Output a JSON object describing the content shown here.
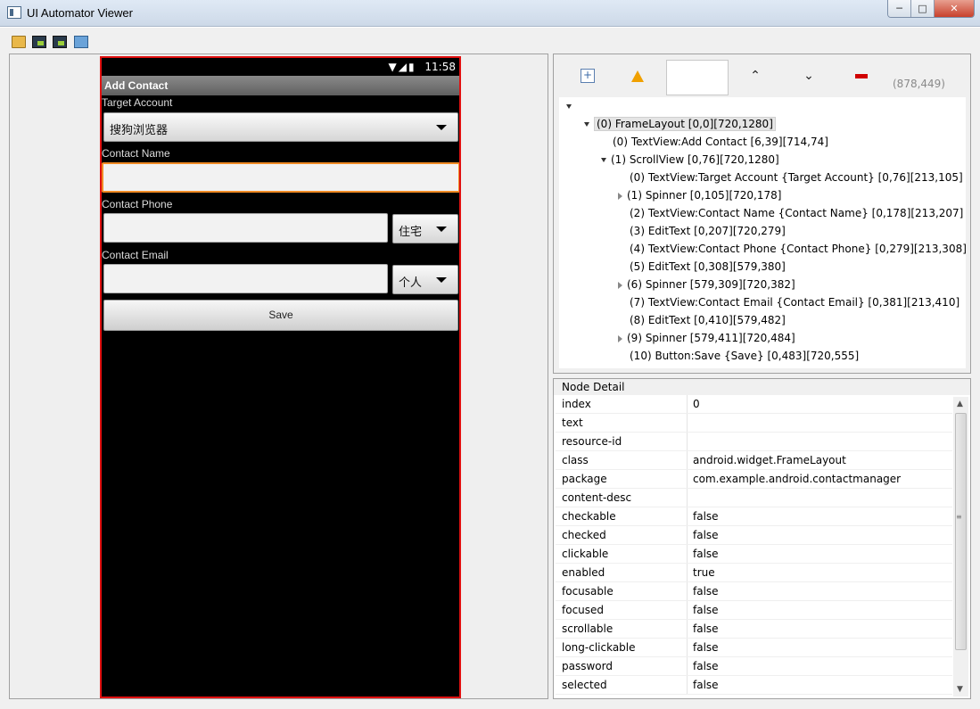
{
  "window": {
    "title": "UI Automator Viewer",
    "controls": [
      "─",
      "□",
      "✕"
    ]
  },
  "toolbar": {
    "icons": [
      "open-folder-icon",
      "device-screenshot-icon",
      "device-screenshot-compressed-icon",
      "save-icon"
    ]
  },
  "phone": {
    "status_time": "11:58",
    "status_icons": "wifi signal battery",
    "actionbar_title": "Add Contact",
    "target_account_label": "Target Account",
    "target_account_value": "搜狗浏览器",
    "contact_name_label": "Contact Name",
    "contact_name_value": "",
    "contact_phone_label": "Contact Phone",
    "contact_phone_value": "",
    "phone_type": "住宅",
    "contact_email_label": "Contact Email",
    "contact_email_value": "",
    "email_type": "个人",
    "save_label": "Save"
  },
  "hierarchy": {
    "search_value": "",
    "coords": "(878,449)",
    "nodes": [
      "(0) FrameLayout [0,0][720,1280]",
      "(0) TextView:Add Contact [6,39][714,74]",
      "(1) ScrollView [0,76][720,1280]",
      "(0) TextView:Target Account {Target Account} [0,76][213,105]",
      "(1) Spinner [0,105][720,178]",
      "(2) TextView:Contact Name {Contact Name} [0,178][213,207]",
      "(3) EditText [0,207][720,279]",
      "(4) TextView:Contact Phone {Contact Phone} [0,279][213,308]",
      "(5) EditText [0,308][579,380]",
      "(6) Spinner [579,309][720,382]",
      "(7) TextView:Contact Email {Contact Email} [0,381][213,410]",
      "(8) EditText [0,410][579,482]",
      "(9) Spinner [579,411][720,484]",
      "(10) Button:Save {Save} [0,483][720,555]"
    ]
  },
  "detail": {
    "title": "Node Detail",
    "rows": [
      {
        "key": "index",
        "value": "0"
      },
      {
        "key": "text",
        "value": ""
      },
      {
        "key": "resource-id",
        "value": ""
      },
      {
        "key": "class",
        "value": "android.widget.FrameLayout"
      },
      {
        "key": "package",
        "value": "com.example.android.contactmanager"
      },
      {
        "key": "content-desc",
        "value": ""
      },
      {
        "key": "checkable",
        "value": "false"
      },
      {
        "key": "checked",
        "value": "false"
      },
      {
        "key": "clickable",
        "value": "false"
      },
      {
        "key": "enabled",
        "value": "true"
      },
      {
        "key": "focusable",
        "value": "false"
      },
      {
        "key": "focused",
        "value": "false"
      },
      {
        "key": "scrollable",
        "value": "false"
      },
      {
        "key": "long-clickable",
        "value": "false"
      },
      {
        "key": "password",
        "value": "false"
      },
      {
        "key": "selected",
        "value": "false"
      }
    ]
  }
}
